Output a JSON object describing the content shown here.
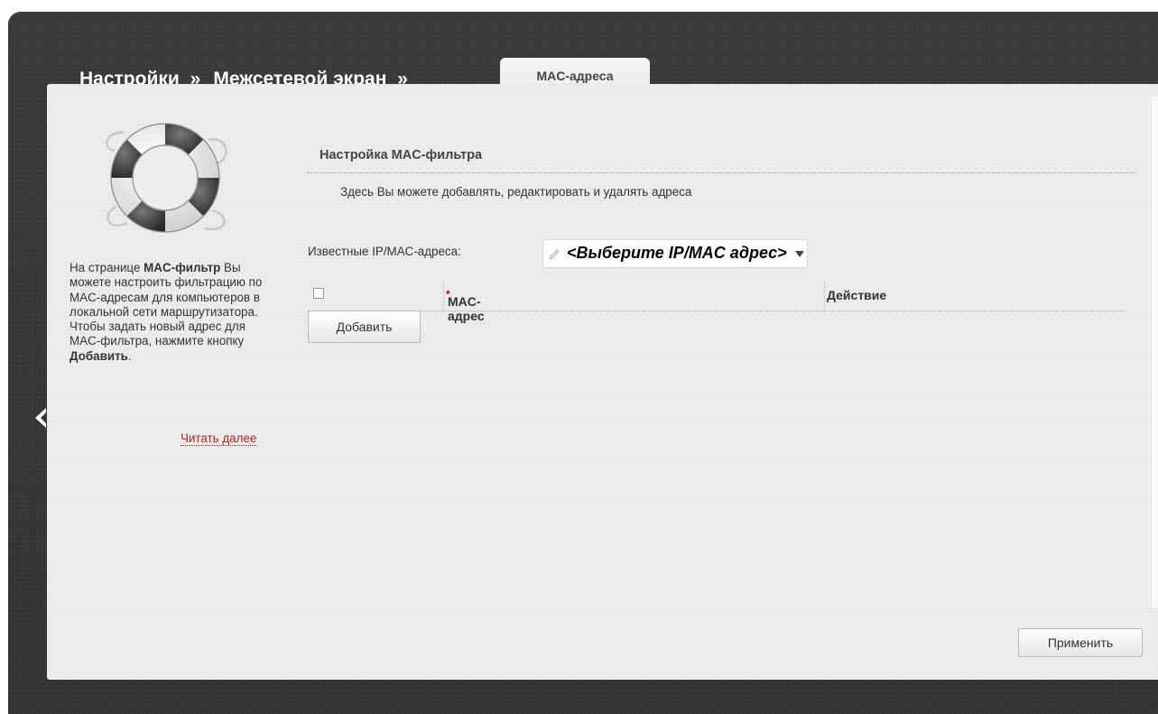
{
  "breadcrumb": {
    "item1": "Настройки",
    "item2": "Межсетевой экран",
    "separator": "»",
    "active_tab": "MAC-адреса"
  },
  "sidebar": {
    "help_intro": "На странице ",
    "help_bold1": "MAC-фильтр",
    "help_mid": " Вы можете настроить фильтрацию по MAC-адресам для компьютеров в локальной сети маршрутизатора. Чтобы задать новый адрес для MAC-фильтра, нажмите кнопку ",
    "help_bold2": "Добавить",
    "help_end": ".",
    "read_more": "Читать далее",
    "illustration_icon": "lifebuoy-icon"
  },
  "main": {
    "section_title": "Настройка MAC-фильтра",
    "section_description": "Здесь Вы можете добавлять, редактировать и удалять адреса",
    "known_label": "Известные IP/MAC-адреса:",
    "known_select_value": "<Выберите IP/MAC адрес>",
    "table": {
      "columns": [
        "MAC-адрес",
        "Действие"
      ],
      "required_mark": "*",
      "rows": []
    },
    "add_button": "Добавить",
    "apply_button": "Применить"
  },
  "icons": {
    "back": "chevron-left-icon",
    "pencil": "pencil-icon",
    "caret": "caret-down-icon"
  }
}
